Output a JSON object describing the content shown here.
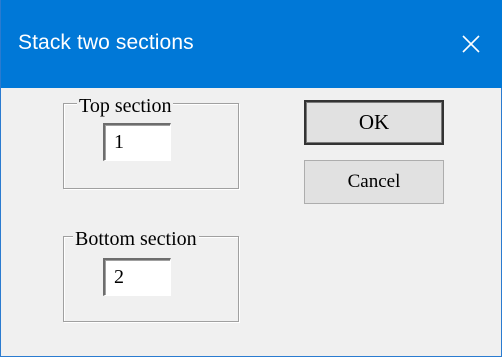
{
  "window": {
    "title": "Stack two sections",
    "close_icon": "close-icon",
    "titlebar_color": "#0078d7"
  },
  "top_section": {
    "legend": "Top section",
    "value": "1"
  },
  "bottom_section": {
    "legend": "Bottom section",
    "value": "2"
  },
  "buttons": {
    "ok_label": "OK",
    "cancel_label": "Cancel"
  }
}
